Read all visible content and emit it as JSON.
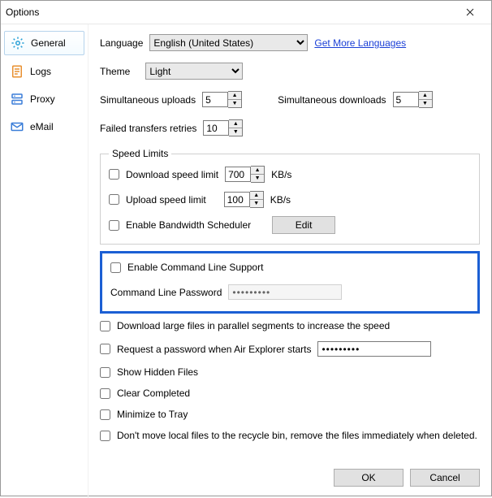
{
  "window": {
    "title": "Options"
  },
  "sidebar": {
    "items": [
      {
        "label": "General"
      },
      {
        "label": "Logs"
      },
      {
        "label": "Proxy"
      },
      {
        "label": "eMail"
      }
    ]
  },
  "general": {
    "language_label": "Language",
    "language_value": "English (United States)",
    "more_languages": "Get More Languages",
    "theme_label": "Theme",
    "theme_value": "Light",
    "sim_uploads_label": "Simultaneous uploads",
    "sim_uploads_value": "5",
    "sim_downloads_label": "Simultaneous downloads",
    "sim_downloads_value": "5",
    "failed_retries_label": "Failed transfers retries",
    "failed_retries_value": "10",
    "speed_limits": {
      "legend": "Speed Limits",
      "download_label": "Download speed limit",
      "download_value": "700",
      "upload_label": "Upload speed limit",
      "upload_value": "100",
      "unit": "KB/s",
      "scheduler_label": "Enable Bandwidth Scheduler",
      "edit_button": "Edit"
    },
    "command_line": {
      "enable_label": "Enable Command Line Support",
      "password_label": "Command Line Password",
      "password_value": "•••••••••"
    },
    "options": {
      "download_parallel": "Download large files in parallel segments to increase the speed",
      "request_password": "Request a password when Air Explorer starts",
      "request_password_value": "•••••••••",
      "show_hidden": "Show Hidden Files",
      "clear_completed": "Clear Completed",
      "minimize_tray": "Minimize to Tray",
      "no_recycle": "Don't move local files to the recycle bin, remove the files immediately when deleted."
    }
  },
  "buttons": {
    "ok": "OK",
    "cancel": "Cancel"
  }
}
